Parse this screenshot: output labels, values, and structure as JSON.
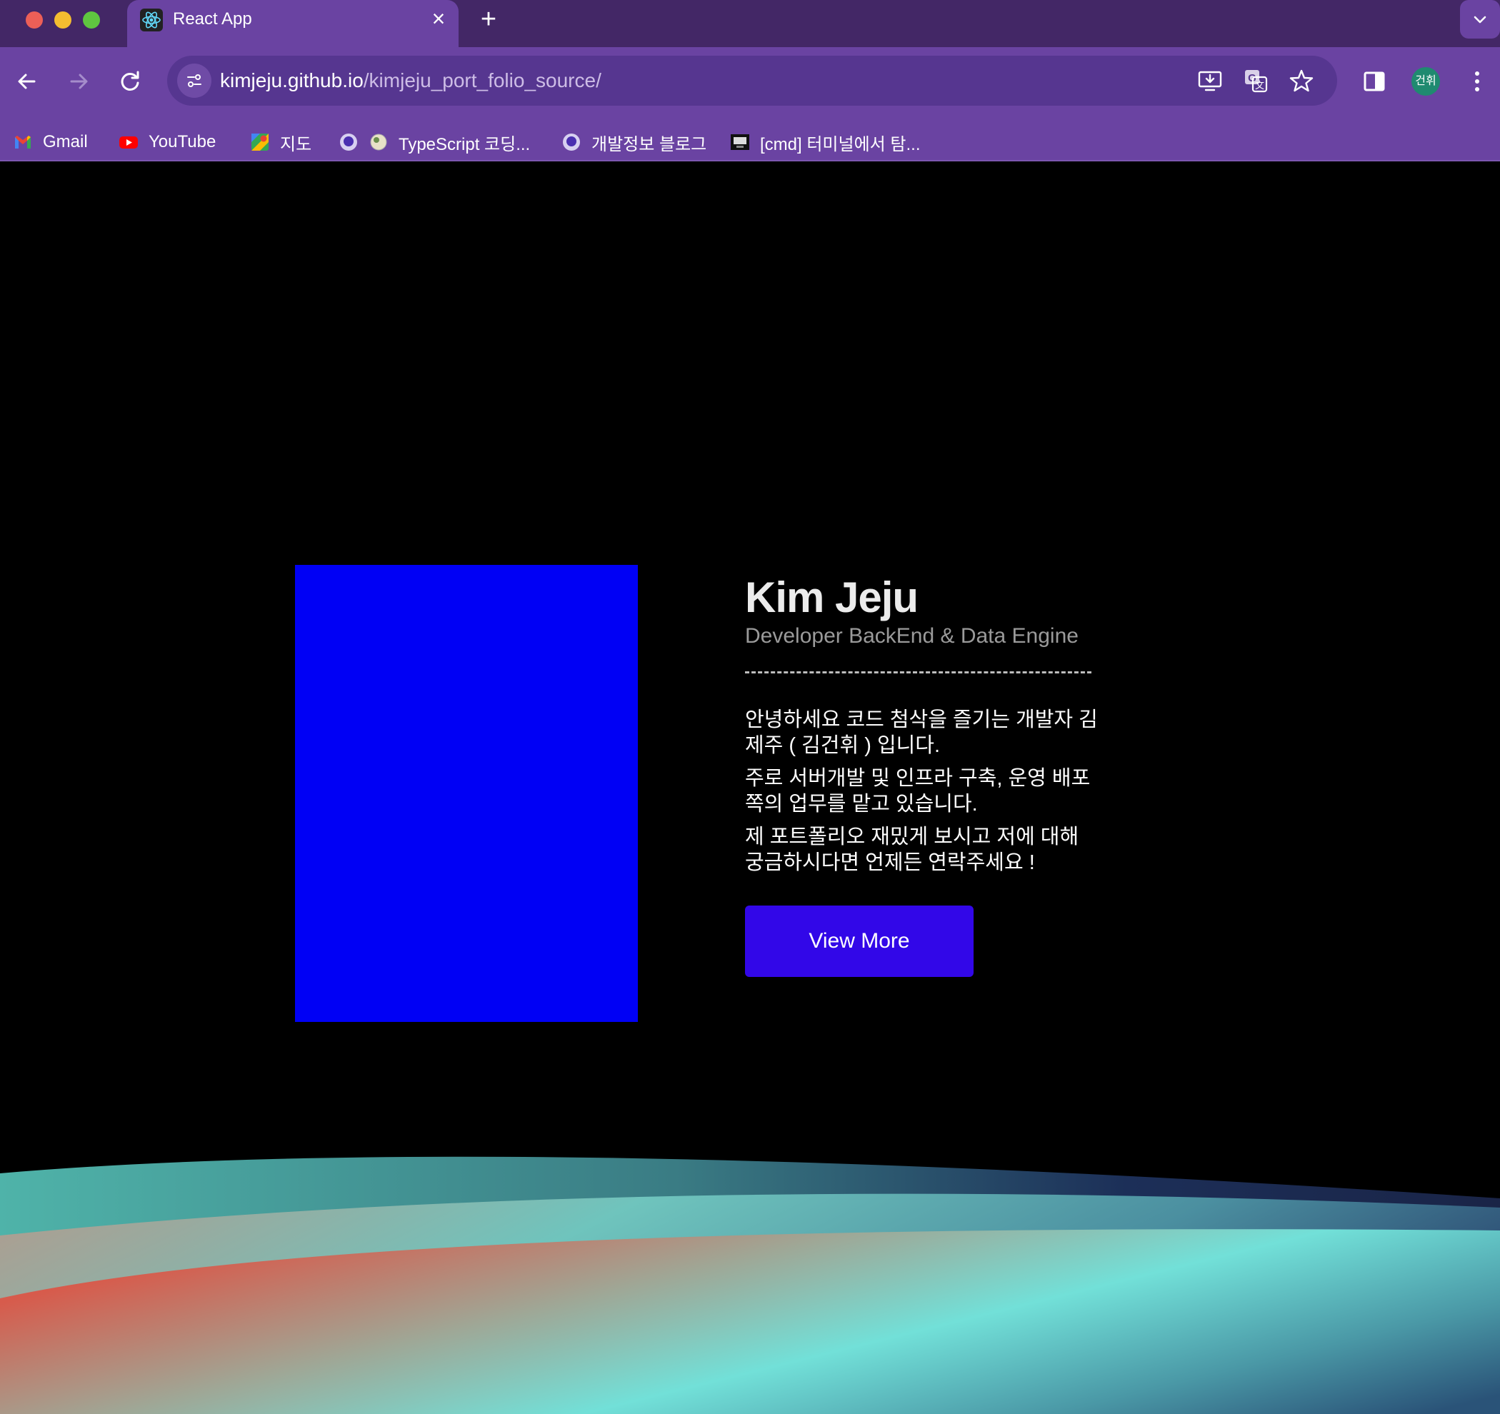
{
  "browser": {
    "tab_title": "React App",
    "url_host": "kimjeju.github.io",
    "url_path": "/kimjeju_port_folio_source/",
    "profile_initials": "건휘",
    "bookmarks": [
      {
        "label": "Gmail",
        "icon": "gmail-icon"
      },
      {
        "label": "YouTube",
        "icon": "youtube-icon"
      },
      {
        "label": "지도",
        "icon": "maps-icon"
      },
      {
        "label": "TypeScript 코딩...",
        "icon": "site-icon"
      },
      {
        "label": "개발정보 블로그",
        "icon": "site-icon"
      },
      {
        "label": "[cmd] 터미널에서 탐...",
        "icon": "terminal-icon"
      }
    ]
  },
  "hero": {
    "name": "Kim Jeju",
    "role": "Developer BackEnd & Data Engine",
    "intro": [
      "안녕하세요 코드 첨삭을 즐기는 개발자 김제주 ( 김건휘 ) 입니다.",
      "주로 서버개발 및 인프라 구축, 운영 배포쪽의 업무를 맡고 있습니다.",
      "제 포트폴리오 재밌게 보시고 저에 대해 궁금하시다면 언제든 연락주세요 !"
    ],
    "button_label": "View More"
  },
  "colors": {
    "chrome_dark": "#432766",
    "chrome": "#6a43a2",
    "photo_placeholder": "#0000f5",
    "button": "#3207e8"
  }
}
